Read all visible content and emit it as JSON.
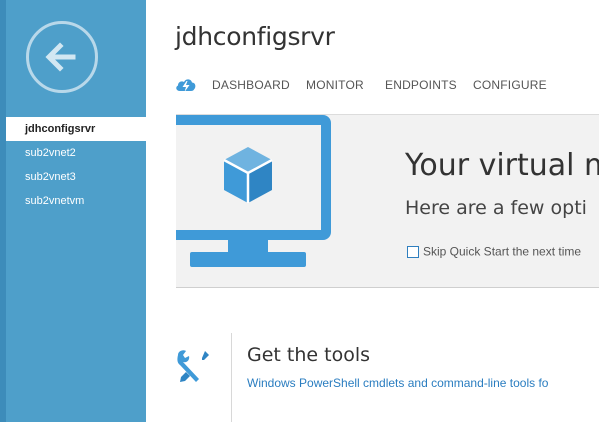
{
  "sidebar": {
    "back_label": "Back",
    "items": [
      {
        "label": "jdhconfigsrvr",
        "selected": true
      },
      {
        "label": "sub2vnet2",
        "selected": false
      },
      {
        "label": "sub2vnet3",
        "selected": false
      },
      {
        "label": "sub2vnetvm",
        "selected": false
      }
    ]
  },
  "header": {
    "title": "jdhconfigsrvr",
    "quickstart_icon": "cloud-lightning-icon",
    "tabs": [
      {
        "label": "DASHBOARD"
      },
      {
        "label": "MONITOR"
      },
      {
        "label": "ENDPOINTS"
      },
      {
        "label": "CONFIGURE"
      }
    ]
  },
  "banner": {
    "headline": "Your virtual ma",
    "subtext": "Here are a few opti",
    "skip_label": "Skip Quick Start the next time",
    "skip_checked": false
  },
  "tools": {
    "heading": "Get the tools",
    "link": "Windows PowerShell cmdlets and command-line tools fo"
  },
  "colors": {
    "nav_background": "#4e9fca",
    "accent_blue": "#3f9ad8",
    "link_blue": "#2a7dc0"
  }
}
